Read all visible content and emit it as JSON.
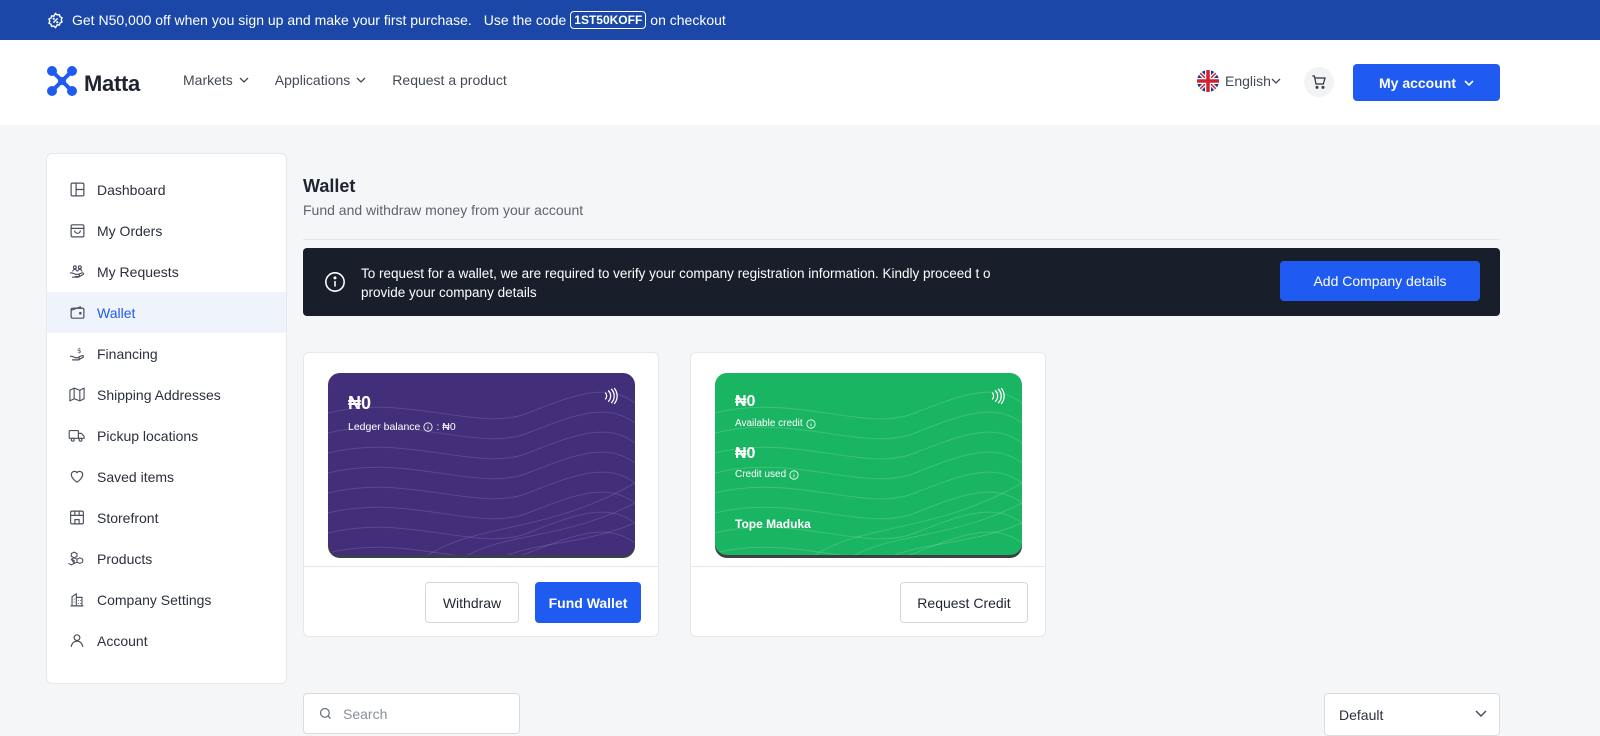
{
  "promo": {
    "text": "Get N50,000 off when you sign up and make your first purchase.",
    "code_prefix": "Use the code",
    "code": "1ST50KOFF",
    "code_suffix": "on checkout",
    "icon": "discount-badge-icon"
  },
  "header": {
    "logo": "Matta",
    "nav": [
      {
        "label": "Markets",
        "dropdown": true
      },
      {
        "label": "Applications",
        "dropdown": true
      },
      {
        "label": "Request a product",
        "dropdown": false
      }
    ],
    "language": "English",
    "account_label": "My account"
  },
  "sidebar": {
    "items": [
      {
        "label": "Dashboard",
        "icon": "layout-icon"
      },
      {
        "label": "My Orders",
        "icon": "shopping-bag-icon"
      },
      {
        "label": "My Requests",
        "icon": "hand-request-icon"
      },
      {
        "label": "Wallet",
        "icon": "wallet-icon",
        "active": true
      },
      {
        "label": "Financing",
        "icon": "financing-icon"
      },
      {
        "label": "Shipping Addresses",
        "icon": "map-icon"
      },
      {
        "label": "Pickup locations",
        "icon": "truck-icon"
      },
      {
        "label": "Saved items",
        "icon": "heart-icon"
      },
      {
        "label": "Storefront",
        "icon": "storefront-icon"
      },
      {
        "label": "Products",
        "icon": "boxes-icon"
      },
      {
        "label": "Company Settings",
        "icon": "building-icon"
      },
      {
        "label": "Account",
        "icon": "user-icon"
      }
    ]
  },
  "main": {
    "title": "Wallet",
    "subtitle": "Fund and withdraw money from your account"
  },
  "notice": {
    "text": "To request for a wallet, we are required to verify your company registration information. Kindly proceed t o provide your company details",
    "button": "Add Company details"
  },
  "wallet_card": {
    "balance": "₦0",
    "ledger_label": "Ledger balance",
    "ledger_value": ": ₦0",
    "withdraw_label": "Withdraw",
    "fund_label": "Fund Wallet",
    "color": "#432e7a"
  },
  "credit_card": {
    "available": "₦0",
    "available_label": "Available credit",
    "used": "₦0",
    "used_label": "Credit used",
    "owner": "Tope Maduka",
    "request_label": "Request Credit",
    "color": "#1ab562"
  },
  "filters": {
    "search_placeholder": "Search",
    "sort_value": "Default"
  },
  "colors": {
    "brand_blue": "#1f5bf0",
    "banner_blue": "#1a47a8",
    "notice_bg": "#181f2b"
  }
}
